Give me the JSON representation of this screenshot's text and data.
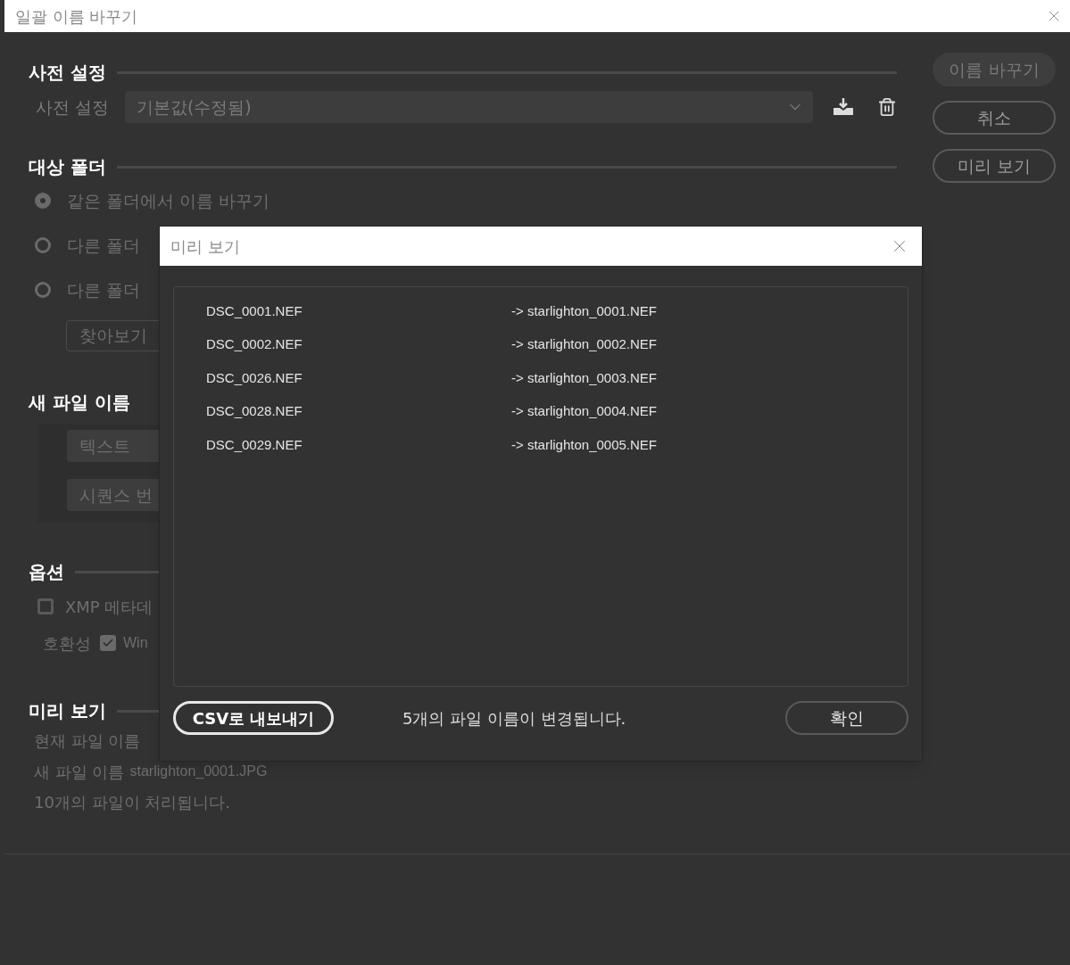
{
  "window": {
    "title": "일괄 이름 바꾸기"
  },
  "buttons": [
    {
      "label": "이름 바꾸기",
      "kind": "filled"
    },
    {
      "label": "취소",
      "kind": "outline"
    },
    {
      "label": "미리 보기",
      "kind": "outline"
    }
  ],
  "preset": {
    "heading": "사전 설정",
    "label": "사전 설정",
    "value": "기본값(수정됨)"
  },
  "target_folder": {
    "heading": "대상 폴더",
    "options": [
      {
        "label": "같은 폴더에서 이름 바꾸기",
        "selected": true
      },
      {
        "label": "다른 폴더",
        "selected": false
      },
      {
        "label": "다른 폴더",
        "selected": false
      }
    ],
    "browse_button": "찾아보기"
  },
  "new_filename": {
    "heading": "새 파일 이름",
    "rows": [
      "텍스트",
      "시퀀스 번"
    ]
  },
  "options": {
    "heading": "옵션",
    "xmp": {
      "label": "XMP 메타데",
      "checked": false
    },
    "compat": {
      "label": "호환성",
      "option": "Win",
      "checked": true
    }
  },
  "preview": {
    "heading": "미리 보기",
    "current_label": "현재 파일 이름",
    "new_label": "새 파일 이름",
    "new_value": "starlighton_0001.JPG",
    "summary": "10개의 파일이 처리됩니다."
  },
  "dialog": {
    "title": "미리 보기",
    "rows": [
      {
        "from": "DSC_0001.NEF",
        "to": "-> starlighton_0001.NEF"
      },
      {
        "from": "DSC_0002.NEF",
        "to": "-> starlighton_0002.NEF"
      },
      {
        "from": "DSC_0026.NEF",
        "to": "-> starlighton_0003.NEF"
      },
      {
        "from": "DSC_0028.NEF",
        "to": "-> starlighton_0004.NEF"
      },
      {
        "from": "DSC_0029.NEF",
        "to": "-> starlighton_0005.NEF"
      }
    ],
    "export_button": "CSV로 내보내기",
    "message": "5개의 파일 이름이 변경됩니다.",
    "ok_button": "확인"
  }
}
